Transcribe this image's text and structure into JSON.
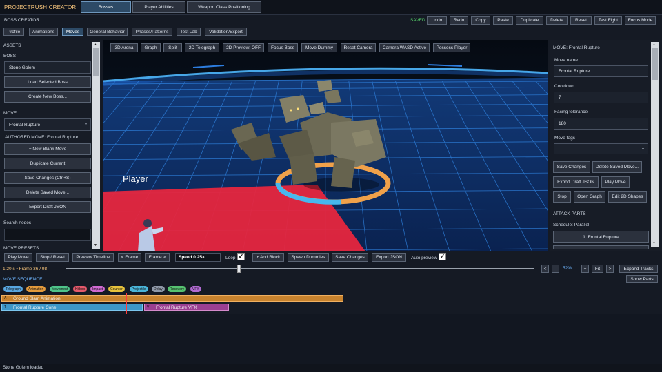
{
  "app": {
    "title": "PROJECTRUSH CREATOR"
  },
  "main_tabs": [
    {
      "label": "Bosses",
      "active": true
    },
    {
      "label": "Player Abilities",
      "active": false
    },
    {
      "label": "Weapon Class Positioning",
      "active": false
    }
  ],
  "header": {
    "section_title": "BOSS CREATOR",
    "status": "SAVED",
    "status_color": "#55d36a",
    "toolbar": [
      "Undo",
      "Redo",
      "Copy",
      "Paste",
      "Duplicate",
      "Delete",
      "Reset",
      "Test Fight",
      "Focus Mode"
    ]
  },
  "sub_tabs": [
    {
      "label": "Profile",
      "active": false
    },
    {
      "label": "Animations",
      "active": false
    },
    {
      "label": "Moves",
      "active": true
    },
    {
      "label": "General Behavior",
      "active": false
    },
    {
      "label": "Phases/Patterns",
      "active": false
    },
    {
      "label": "Test Lab",
      "active": false
    },
    {
      "label": "Validation/Export",
      "active": false
    }
  ],
  "left_panel": {
    "assets_label": "ASSETS",
    "boss_label": "BOSS",
    "boss_value": "Stone Golem",
    "load_button": "Load Selected Boss",
    "create_button": "Create New Boss...",
    "move_label": "MOVE",
    "move_value": "Frontal Rupture",
    "authored_label": "AUTHORED MOVE: Frontal Rupture",
    "buttons": [
      "+ New Blank Move",
      "Duplicate Current",
      "Save Changes (Ctrl+S)",
      "Delete Saved Move...",
      "Export Draft JSON"
    ],
    "search_label": "Search nodes",
    "search_value": "",
    "cut_label": "MOVE PRESETS"
  },
  "viewport": {
    "toolbar": [
      "3D Arena",
      "Graph",
      "Split",
      "2D Telegraph",
      "2D Preview: OFF",
      "Focus Boss",
      "Move Dummy",
      "Reset Camera",
      "Camera WASD Active",
      "Possess Player"
    ],
    "player_label": "Player",
    "colors": {
      "floor": "#0d2a5a",
      "grid": "#2f7bd8",
      "telegraph": "#e6263e",
      "ring_orange": "#f0a14a",
      "ring_blue": "#47b7ee"
    }
  },
  "right_panel": {
    "title": "MOVE: Frontal Rupture",
    "move_name_label": "Move name",
    "move_name_value": "Frontal Rupture",
    "cooldown_label": "Cooldown",
    "cooldown_value": "7",
    "facing_label": "Facing tolerance",
    "facing_value": "180",
    "tags_label": "Move tags",
    "tags_value": "",
    "buttons_row1": [
      "Save Changes",
      "Delete Saved Move..."
    ],
    "buttons_row2": [
      "Export Draft JSON",
      "Play Move"
    ],
    "buttons_row3": [
      "Stop",
      "Open Graph",
      "Edit 2D Shapes"
    ],
    "attack_parts_label": "ATTACK PARTS",
    "schedule_label": "Schedule: Parallel",
    "parts": [
      "1. Frontal Rupture"
    ]
  },
  "timeline": {
    "controls": [
      "Play Move",
      "Stop / Reset",
      "Preview Timeline",
      "< Frame",
      "Frame >"
    ],
    "speed_value": "Speed 0.25×",
    "loop_label": "Loop",
    "loop_checked": true,
    "controls2": [
      "+ Add Block",
      "Spawn Dummies",
      "Save Changes",
      "Export JSON"
    ],
    "auto_preview_label": "Auto preview",
    "auto_preview_checked": true,
    "frame_info": "1.20 s  •  Frame 36 / 98",
    "scrub_fraction": 0.37,
    "zoom_buttons": [
      "<",
      "-"
    ],
    "zoom_level": "52%",
    "zoom_buttons2": [
      "+",
      "Fit",
      ">"
    ],
    "expand_button": "Expand Tracks",
    "show_parts_button": "Show Parts",
    "sequence_title": "MOVE SEQUENCE",
    "chips": [
      {
        "label": "Telegraph",
        "color": "#58a6e0"
      },
      {
        "label": "Animation",
        "color": "#e39a3c"
      },
      {
        "label": "Movement",
        "color": "#4fc48a"
      },
      {
        "label": "Hitbox",
        "color": "#e4596b"
      },
      {
        "label": "Impact",
        "color": "#d06ad2"
      },
      {
        "label": "Counter",
        "color": "#e6c23c"
      },
      {
        "label": "Projectile",
        "color": "#4ab4d8"
      },
      {
        "label": "Delay",
        "color": "#8e98a8"
      },
      {
        "label": "Recovery",
        "color": "#56c270"
      },
      {
        "label": "VFX",
        "color": "#b06ad2"
      }
    ],
    "tracks": [
      {
        "label": "Ground Slam Animation",
        "tag": "A",
        "color": "#c8832e"
      },
      {
        "label": "Frontal Rupture Cone",
        "tag": "T",
        "color": "#3d97c8"
      },
      {
        "label": "Frontal Rupture VFX",
        "tag": "V",
        "color": "#9b3f92"
      }
    ]
  },
  "status_bar": {
    "text": "Stone Golem loaded"
  }
}
